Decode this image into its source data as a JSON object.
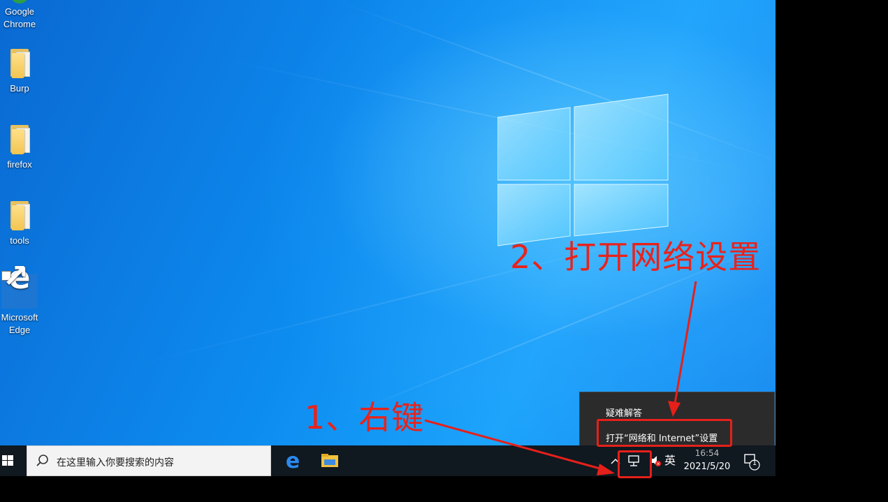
{
  "desktop": {
    "icons": [
      {
        "label_line1": "Google",
        "label_line2": "Chrome",
        "icon": "chrome-icon"
      },
      {
        "label_line1": "Burp",
        "label_line2": "",
        "icon": "folder-icon"
      },
      {
        "label_line1": "firefox",
        "label_line2": "",
        "icon": "folder-icon"
      },
      {
        "label_line1": "tools",
        "label_line2": "",
        "icon": "folder-icon"
      },
      {
        "label_line1": "Microsoft",
        "label_line2": "Edge",
        "icon": "edge-icon"
      }
    ]
  },
  "taskbar": {
    "search_placeholder": "在这里输入你要搜索的内容",
    "tray": {
      "language": "英",
      "time": "16:54",
      "date": "2021/5/20",
      "notification_count": "1"
    }
  },
  "context_menu": {
    "items": [
      {
        "label": "疑难解答"
      },
      {
        "label": "打开“网络和 Internet”设置"
      }
    ]
  },
  "annotations": {
    "step1": "1、右键",
    "step2": "2、打开网络设置",
    "color": "#e8231c"
  }
}
